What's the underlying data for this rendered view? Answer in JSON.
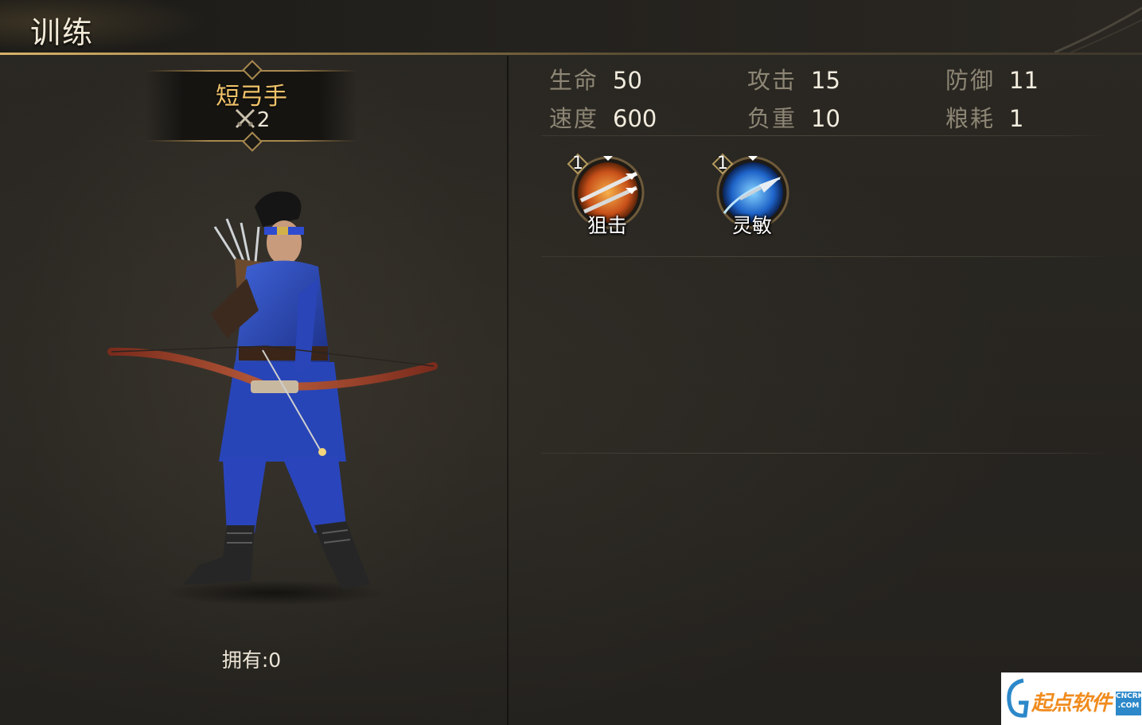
{
  "header": {
    "title": "训练"
  },
  "unit": {
    "name": "短弓手",
    "count": "2",
    "owned": "拥有:0"
  },
  "stats": [
    {
      "label": "生命",
      "value": "50"
    },
    {
      "label": "攻击",
      "value": "15"
    },
    {
      "label": "防御",
      "value": "11"
    },
    {
      "label": "速度",
      "value": "600"
    },
    {
      "label": "负重",
      "value": "10"
    },
    {
      "label": "粮耗",
      "value": "1"
    }
  ],
  "skills": [
    {
      "name": "狙击",
      "level": "1",
      "icon": "arrows-icon",
      "color": "#e07a1e"
    },
    {
      "name": "灵敏",
      "level": "1",
      "icon": "arrowhead-icon",
      "color": "#2e86d8"
    }
  ],
  "watermark": {
    "text": "起点软件",
    "badge_top": "CNCRK",
    "badge_bottom": ".COM"
  },
  "colors": {
    "accent_gold": "#f0c36a",
    "stat_label": "#8d8675",
    "stat_value": "#f2ecde"
  }
}
